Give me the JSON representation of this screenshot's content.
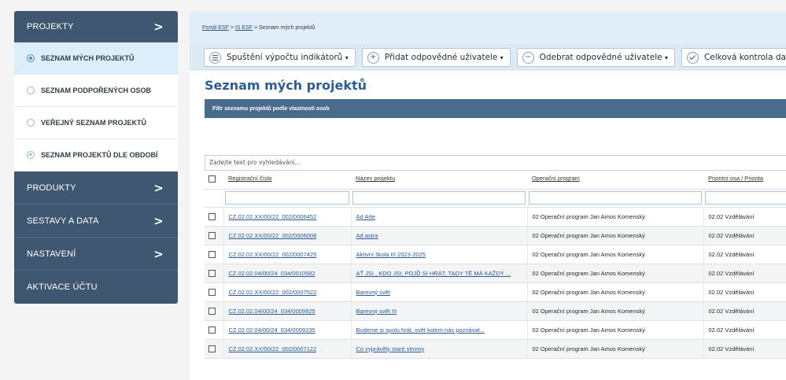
{
  "sidebar": {
    "sections": [
      {
        "label": "PROJEKTY",
        "chevron": ">"
      },
      {
        "label": "PRODUKTY",
        "chevron": ">"
      },
      {
        "label": "SESTAVY A DATA",
        "chevron": ">"
      },
      {
        "label": "NASTAVENÍ",
        "chevron": ">"
      },
      {
        "label": "AKTIVACE ÚČTU"
      }
    ],
    "project_items": [
      {
        "label": "SEZNAM MÝCH PROJEKTŮ",
        "icon": "radio-selected-icon",
        "active": true
      },
      {
        "label": "SEZNAM PODPOŘENÝCH OSOB",
        "icon": "radio-icon"
      },
      {
        "label": "VEŘEJNÝ SEZNAM PROJEKTŮ",
        "icon": "radio-icon"
      },
      {
        "label": "SEZNAM PROJEKTŮ DLE OBDOBÍ",
        "icon": "plus-circle-icon"
      }
    ]
  },
  "breadcrumb": {
    "items": [
      "Portál ESF",
      "IS ESF",
      "Seznam mých projektů"
    ],
    "separator": ">"
  },
  "toolbar": {
    "buttons": [
      {
        "label": "Spuštění výpočtu indikátorů",
        "icon": "list-icon",
        "caret": "▾"
      },
      {
        "label": "Přidat odpovědné uživatele",
        "icon": "plus-circle-icon",
        "caret": "▾"
      },
      {
        "label": "Odebrat odpovědné uživatele",
        "icon": "minus-circle-icon",
        "caret": "▾"
      },
      {
        "label": "Celková kontrola dat",
        "icon": "check-circle-icon"
      }
    ]
  },
  "page": {
    "title": "Seznam mých projektů"
  },
  "filter": {
    "title": "Filtr seznamu projektů podle vlastností osob"
  },
  "search": {
    "placeholder": "Zadejte text pro vyhledávání..."
  },
  "table": {
    "columns": [
      "Registrační číslo",
      "Název projektu",
      "Operační program",
      "Prioritní osa / Priorita"
    ],
    "rows": [
      {
        "reg": "CZ.02.02.XX/00/22_002/0006452",
        "name": "Ad Arte",
        "program": "02 Operační program Jan Amos Komenský",
        "priority": "02.02 Vzdělávání"
      },
      {
        "reg": "CZ.02.02.XX/00/22_002/0006008",
        "name": "Ad astra",
        "program": "02 Operační program Jan Amos Komenský",
        "priority": "02.02 Vzdělávání"
      },
      {
        "reg": "CZ.02.02.XX/00/22_002/0007425",
        "name": "Aktivní škola III 2023-2025",
        "program": "02 Operační program Jan Amos Komenský",
        "priority": "02.02 Vzdělávání"
      },
      {
        "reg": "CZ.02.02.04/00/24_034/0010582",
        "name": "AŤ JSI , KDO JSI, POJĎ SI HRÁT, TADY TĚ MÁ KAŽDÝ ...",
        "program": "02 Operační program Jan Amos Komenský",
        "priority": "02.02 Vzdělávání"
      },
      {
        "reg": "CZ.02.02.XX/00/22_002/0007522",
        "name": "Barevný svět",
        "program": "02 Operační program Jan Amos Komenský",
        "priority": "02.02 Vzdělávání"
      },
      {
        "reg": "CZ.02.02.04/00/24_034/0009925",
        "name": "Barevný svět III",
        "program": "02 Operační program Jan Amos Komenský",
        "priority": "02.02 Vzdělávání"
      },
      {
        "reg": "CZ.02.02.04/00/24_034/0009235",
        "name": "Budeme si spolu hrát, svět kolem nás poznávat...",
        "program": "02 Operační program Jan Amos Komenský",
        "priority": "02.02 Vzdělávání"
      },
      {
        "reg": "CZ.02.02.XX/00/22_002/0007122",
        "name": "Co vyprávěly staré stromy",
        "program": "02 Operační program Jan Amos Komenský",
        "priority": "02.02 Vzdělávání"
      }
    ]
  }
}
